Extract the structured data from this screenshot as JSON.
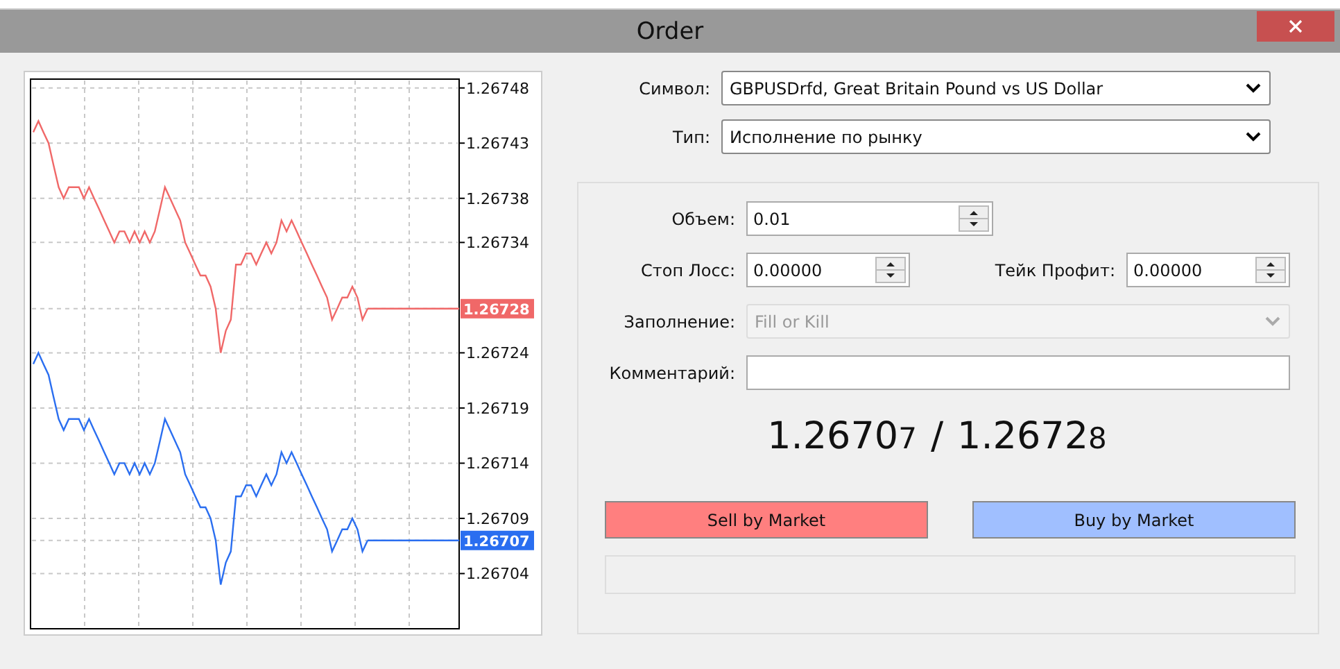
{
  "window": {
    "title": "Order"
  },
  "chart": {
    "chart_data": {
      "type": "line",
      "categories": [
        null,
        null,
        null,
        null,
        null,
        null,
        null,
        null,
        null,
        null,
        null,
        null,
        null,
        null,
        null,
        null,
        null,
        null,
        null,
        null,
        null,
        null,
        null,
        null,
        null,
        null,
        null,
        null,
        null,
        null,
        null,
        null,
        null,
        null,
        null,
        null,
        null,
        null,
        null,
        null,
        null,
        null,
        null,
        null,
        null,
        null,
        null,
        null,
        null,
        null,
        null,
        null,
        null,
        null,
        null,
        null,
        null,
        null,
        null,
        null,
        null,
        null,
        null,
        null,
        null,
        null,
        null
      ],
      "series": [
        {
          "color": "#f06868",
          "values": [
            1.26744,
            1.26745,
            1.26744,
            1.26743,
            1.26741,
            1.26739,
            1.26738,
            1.26739,
            1.26739,
            1.26739,
            1.26738,
            1.26739,
            1.26738,
            1.26737,
            1.26736,
            1.26735,
            1.26734,
            1.26735,
            1.26735,
            1.26734,
            1.26735,
            1.26734,
            1.26735,
            1.26734,
            1.26735,
            1.26737,
            1.26739,
            1.26738,
            1.26737,
            1.26736,
            1.26734,
            1.26733,
            1.26732,
            1.26731,
            1.26731,
            1.2673,
            1.26728,
            1.26724,
            1.26726,
            1.26727,
            1.26732,
            1.26732,
            1.26733,
            1.26733,
            1.26732,
            1.26733,
            1.26734,
            1.26733,
            1.26734,
            1.26736,
            1.26735,
            1.26736,
            1.26735,
            1.26734,
            1.26733,
            1.26732,
            1.26731,
            1.2673,
            1.26729,
            1.26727,
            1.26728,
            1.26729,
            1.26729,
            1.2673,
            1.26729,
            1.26727,
            1.26728
          ]
        },
        {
          "color": "#2a6ef0",
          "values": [
            1.26723,
            1.26724,
            1.26723,
            1.26722,
            1.2672,
            1.26718,
            1.26717,
            1.26718,
            1.26718,
            1.26718,
            1.26717,
            1.26718,
            1.26717,
            1.26716,
            1.26715,
            1.26714,
            1.26713,
            1.26714,
            1.26714,
            1.26713,
            1.26714,
            1.26713,
            1.26714,
            1.26713,
            1.26714,
            1.26716,
            1.26718,
            1.26717,
            1.26716,
            1.26715,
            1.26713,
            1.26712,
            1.26711,
            1.2671,
            1.2671,
            1.26709,
            1.26707,
            1.26703,
            1.26705,
            1.26706,
            1.26711,
            1.26711,
            1.26712,
            1.26712,
            1.26711,
            1.26712,
            1.26713,
            1.26712,
            1.26713,
            1.26715,
            1.26714,
            1.26715,
            1.26714,
            1.26713,
            1.26712,
            1.26711,
            1.2671,
            1.26709,
            1.26708,
            1.26706,
            1.26707,
            1.26708,
            1.26708,
            1.26709,
            1.26708,
            1.26706,
            1.26707
          ]
        }
      ],
      "ylim": [
        1.26699,
        1.267488
      ],
      "yticks": [
        {
          "value": 1.26748,
          "label": "1.26748"
        },
        {
          "value": 1.26743,
          "label": "1.26743"
        },
        {
          "value": 1.26738,
          "label": "1.26738"
        },
        {
          "value": 1.26734,
          "label": "1.26734"
        },
        {
          "value": 1.26724,
          "label": "1.26724"
        },
        {
          "value": 1.26719,
          "label": "1.26719"
        },
        {
          "value": 1.26714,
          "label": "1.26714"
        },
        {
          "value": 1.26709,
          "label": "1.26709"
        },
        {
          "value": 1.26704,
          "label": "1.26704"
        }
      ],
      "grid": true
    },
    "price_markers": [
      "1.26728",
      "1.26707"
    ]
  },
  "symbol": {
    "label": "Символ:",
    "value": "GBPUSDrfd, Great Britain Pound vs US Dollar"
  },
  "type": {
    "label": "Тип:",
    "value": "Исполнение по рынку"
  },
  "volume": {
    "label": "Объем:",
    "value": "0.01"
  },
  "stop_loss": {
    "label": "Стоп Лосс:",
    "value": "0.00000"
  },
  "take_profit": {
    "label": "Тейк Профит:",
    "value": "0.00000"
  },
  "filling": {
    "label": "Заполнение:",
    "value": "Fill or Kill",
    "disabled": true
  },
  "comment": {
    "label": "Комментарий:"
  },
  "quote": {
    "bid": {
      "main": "1.2670",
      "small": "7"
    },
    "separator": "/",
    "ask": {
      "main": "1.2672",
      "small": "8"
    }
  },
  "buttons": [
    {
      "label": "Sell by Market",
      "kind": "sell"
    },
    {
      "label": "Buy by Market",
      "kind": "buy"
    }
  ]
}
